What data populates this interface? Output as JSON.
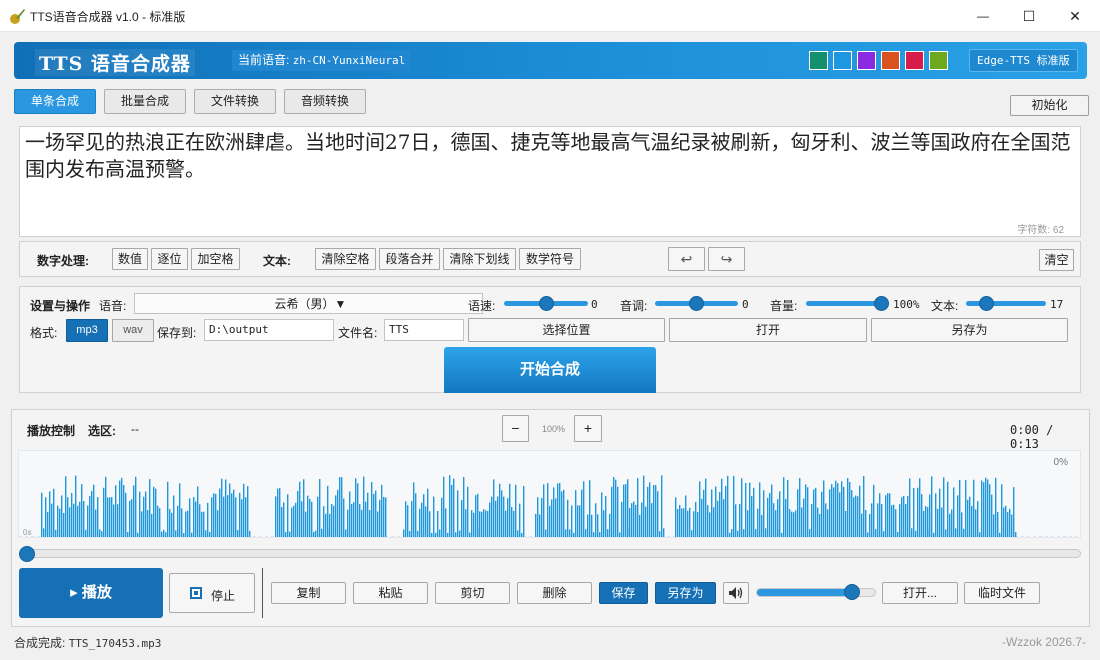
{
  "window": {
    "title": "TTS语音合成器 v1.0 - 标准版",
    "minimize": "—",
    "maximize": "☐",
    "close": "✕"
  },
  "header": {
    "title": "TTS 语音合成器",
    "voice_label": "当前语音:",
    "voice_value": "zh-CN-YunxiNeural",
    "swatches": [
      "#13906c",
      "#1d97e0",
      "#8a2be2",
      "#d9531e",
      "#d51c4a",
      "#6ea81f"
    ],
    "edition": "Edge-TTS 标准版"
  },
  "tabs": [
    {
      "label": "单条合成",
      "active": true
    },
    {
      "label": "批量合成",
      "active": false
    },
    {
      "label": "文件转换",
      "active": false
    },
    {
      "label": "音频转换",
      "active": false
    }
  ],
  "init_button": "初始化",
  "editor": {
    "text": "一场罕见的热浪正在欧洲肆虐。当地时间27日，德国、捷克等地最高气温纪录被刷新，匈牙利、波兰等国政府在全国范围内发布高温预警。",
    "char_count": "字符数: 62"
  },
  "number_processing": {
    "label": "数字处理:",
    "buttons": [
      "数值",
      "逐位",
      "加空格"
    ],
    "text_label": "文本:",
    "text_buttons": [
      "清除空格",
      "段落合并",
      "清除下划线",
      "数学符号"
    ],
    "undo": "↩",
    "redo": "↪",
    "clear": "清空"
  },
  "settings": {
    "title": "设置与操作",
    "voice_label": "语音:",
    "voice_value": "云希（男）▼",
    "speed_label": "语速:",
    "speed_value": "0",
    "speed_level": 0.5,
    "pitch_label": "音调:",
    "pitch_value": "0",
    "pitch_level": 0.5,
    "volume_label": "音量:",
    "volume_value": "100%",
    "volume_level": 1.0,
    "text_label": "文本:",
    "text_value": "17",
    "text_level": 0.2,
    "format_label": "格式:",
    "format_mp3": "mp3",
    "format_wav": "wav",
    "save_to_label": "保存到:",
    "save_to_value": "D:\\output",
    "filename_label": "文件名:",
    "filename_value": "TTS",
    "choose_location": "选择位置",
    "open": "打开",
    "save_as": "另存为",
    "start": "开始合成"
  },
  "playback": {
    "title": "播放控制",
    "selection_label": "选区:",
    "selection_value": "--",
    "zoom_minus": "−",
    "zoom_value": "100%",
    "zoom_plus": "+",
    "time": "0:00 / 0:13",
    "percent": "0%",
    "tick_start": "0s",
    "progress": 0,
    "play": "▸ 播放",
    "stop": "停止",
    "actions": [
      "复制",
      "粘贴",
      "剪切",
      "删除"
    ],
    "save": "保存",
    "save_as": "另存为",
    "volume_level": 0.85,
    "open": "打开...",
    "temp_file": "临时文件"
  },
  "status": {
    "left_label": "合成完成:",
    "left_value": "TTS_170453.mp3",
    "right": "-Wzzok 2026.7-"
  }
}
